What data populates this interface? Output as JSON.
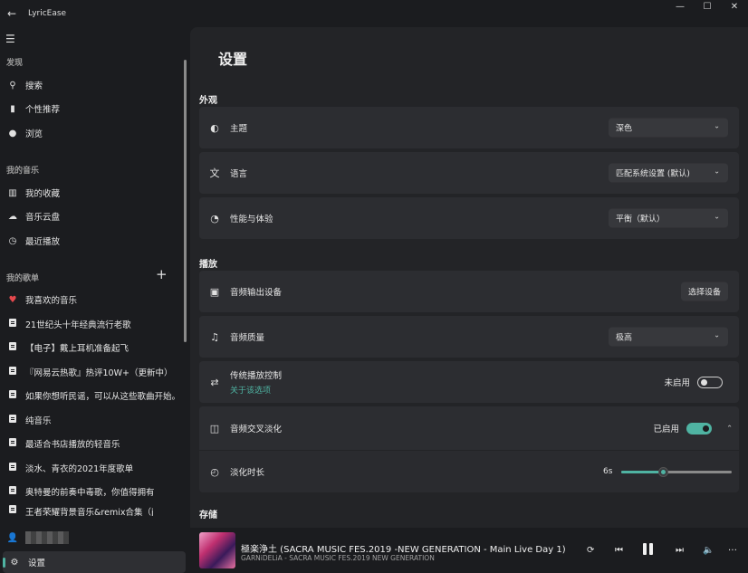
{
  "app": {
    "title": "LyricEase"
  },
  "window_controls": {
    "minimize": "—",
    "maximize": "☐",
    "close": "✕"
  },
  "sidebar": {
    "discover_title": "发现",
    "discover_items": [
      {
        "label": "搜索",
        "icon": "search-icon"
      },
      {
        "label": "个性推荐",
        "icon": "bookmark-icon"
      },
      {
        "label": "浏览",
        "icon": "globe-icon"
      }
    ],
    "my_music_title": "我的音乐",
    "my_music_items": [
      {
        "label": "我的收藏",
        "icon": "library-icon"
      },
      {
        "label": "音乐云盘",
        "icon": "cloud-icon"
      },
      {
        "label": "最近播放",
        "icon": "clock-icon"
      }
    ],
    "playlists_title": "我的歌单",
    "playlists": [
      "我喜欢的音乐",
      "21世纪头十年经典流行老歌",
      "【电子】戴上耳机准备起飞",
      "『网易云热歌』热评10W+（更新中）",
      "如果你想听民谣，可以从这些歌曲开始。",
      "纯音乐",
      "最适合书店播放的轻音乐",
      "淡水、青衣的2021年度歌单",
      "奥特曼的前奏中毒歌，你值得拥有",
      "王者荣耀背景音乐&remix合集（j"
    ],
    "settings_label": "设置"
  },
  "settings": {
    "page_title": "设置",
    "appearance_title": "外观",
    "theme": {
      "label": "主题",
      "value": "深色"
    },
    "language": {
      "label": "语言",
      "value": "匹配系统设置 (默认)"
    },
    "performance": {
      "label": "性能与体验",
      "value": "平衡（默认）"
    },
    "playback_title": "播放",
    "audio_output": {
      "label": "音频输出设备",
      "button": "选择设备"
    },
    "audio_quality": {
      "label": "音频质量",
      "value": "极高"
    },
    "legacy_control": {
      "label": "传统播放控制",
      "sub": "关于该选项",
      "state": "未启用"
    },
    "crossfade": {
      "label": "音频交叉淡化",
      "state": "已启用"
    },
    "fade_duration": {
      "label": "淡化时长",
      "value": "6s",
      "fraction": 0.38
    },
    "storage_title": "存储"
  },
  "player": {
    "title": "極楽浄土 (SACRA MUSIC FES.2019 -NEW GENERATION - Main Live Day 1)",
    "subtitle": "GARNiDELiA - SACRA MUSIC FES.2019 NEW GENERATION"
  },
  "colors": {
    "accent": "#4fb3a2",
    "heart": "#e5484d"
  }
}
